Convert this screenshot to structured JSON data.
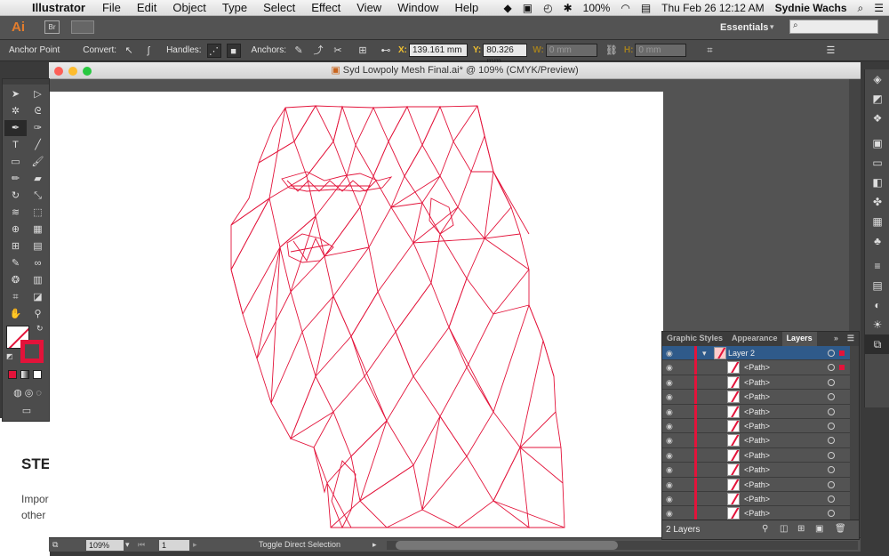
{
  "menubar": {
    "app": "Illustrator",
    "items": [
      "File",
      "Edit",
      "Object",
      "Type",
      "Select",
      "Effect",
      "View",
      "Window",
      "Help"
    ],
    "battery": "100%",
    "clock": "Thu Feb 26  12:12 AM",
    "user": "Sydnie Wachs"
  },
  "appbar": {
    "logo": "Ai",
    "bridge": "Br",
    "workspace": "Essentials",
    "search_placeholder": ""
  },
  "control": {
    "context": "Anchor Point",
    "convert": "Convert:",
    "handles": "Handles:",
    "anchors": "Anchors:",
    "x_label": "X:",
    "x_value": "139.161 mm",
    "y_label": "Y:",
    "y_value": "80.326 mm",
    "w_label": "W:",
    "w_value": "0 mm",
    "h_label": "H:",
    "h_value": "0 mm"
  },
  "document": {
    "title": "Syd Lowpoly Mesh Final.ai* @ 109% (CMYK/Preview)",
    "zoom": "109%",
    "page": "1",
    "status": "Toggle Direct Selection"
  },
  "background_page": {
    "heading": "STE",
    "line1": "Impor",
    "line2": "other"
  },
  "layers_panel": {
    "tabs": [
      "Graphic Styles",
      "Appearance",
      "Layers"
    ],
    "active_tab": "Layers",
    "layer_name": "Layer 2",
    "paths": [
      "<Path>",
      "<Path>",
      "<Path>",
      "<Path>",
      "<Path>",
      "<Path>",
      "<Path>",
      "<Path>",
      "<Path>",
      "<Path>",
      "<Path>"
    ],
    "count": "2 Layers"
  },
  "colors": {
    "accent": "#e3133a",
    "selection": "#2f5a8a",
    "panel": "#535353"
  }
}
